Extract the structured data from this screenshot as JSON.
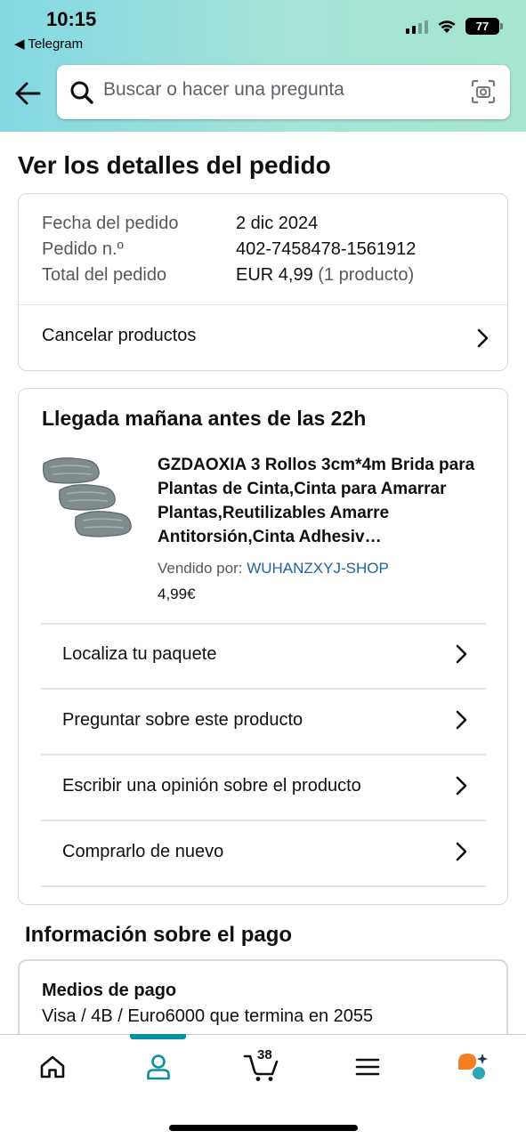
{
  "status_bar": {
    "time": "10:15",
    "back_app": "◀ Telegram",
    "battery": "77"
  },
  "search": {
    "placeholder": "Buscar o hacer una pregunta"
  },
  "page_title": "Ver los detalles del pedido",
  "order": {
    "date_label": "Fecha del pedido",
    "date_value": "2 dic 2024",
    "number_label": "Pedido n.º",
    "number_value": "402-7458478-1561912",
    "total_label": "Total del pedido",
    "total_value": "EUR 4,99",
    "total_note": "(1 producto)",
    "cancel_label": "Cancelar productos"
  },
  "shipment": {
    "delivery_title": "Llegada mañana antes de las 22h",
    "product_title": "GZDAOXIA 3 Rollos 3cm*4m Brida para Plantas de Cinta,Cinta para Amarrar Plantas,Reutilizables Amarre Antitorsión,Cinta Adhesiv…",
    "seller_label": "Vendido por:",
    "seller_name": "WUHANZXYJ-SHOP",
    "price": "4,99€",
    "actions": [
      {
        "label": "Localiza tu paquete"
      },
      {
        "label": "Preguntar sobre este producto"
      },
      {
        "label": "Escribir una opinión sobre el producto"
      },
      {
        "label": "Comprarlo de nuevo"
      }
    ]
  },
  "payment": {
    "section_title": "Información sobre el pago",
    "method_label": "Medios de pago",
    "method_value": "Visa / 4B / Euro6000  que termina en 2055"
  },
  "bottom_nav": {
    "cart_count": "38",
    "active_tab": "account",
    "accent_color": "#0a8fa0"
  }
}
